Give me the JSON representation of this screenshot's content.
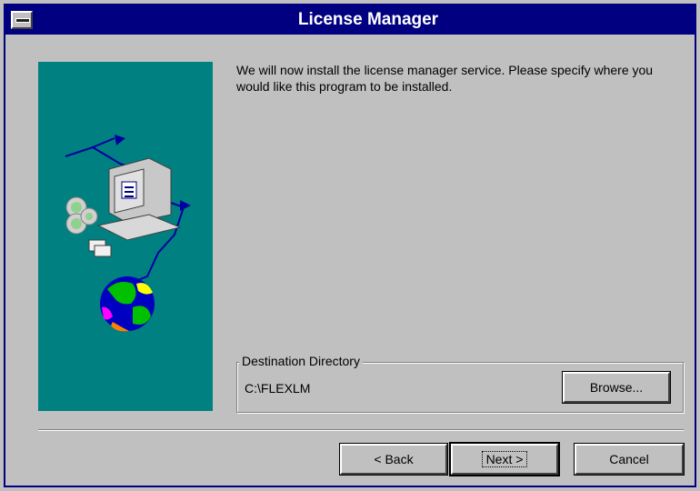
{
  "window": {
    "title": "License Manager"
  },
  "content": {
    "message": "We will now install the license manager service.  Please specify where you would like this program to be installed."
  },
  "destination": {
    "group_label": "Destination Directory",
    "path": "C:\\FLEXLM",
    "browse_label": "Browse..."
  },
  "buttons": {
    "back_label": "< Back",
    "next_label": "Next >",
    "cancel_label": "Cancel"
  },
  "icons": {
    "system_menu": "system-menu-icon",
    "artwork": "computer-network-illustration"
  },
  "colors": {
    "title_bar": "#000080",
    "art_panel": "#008080",
    "dialog": "#c0c0c0"
  }
}
